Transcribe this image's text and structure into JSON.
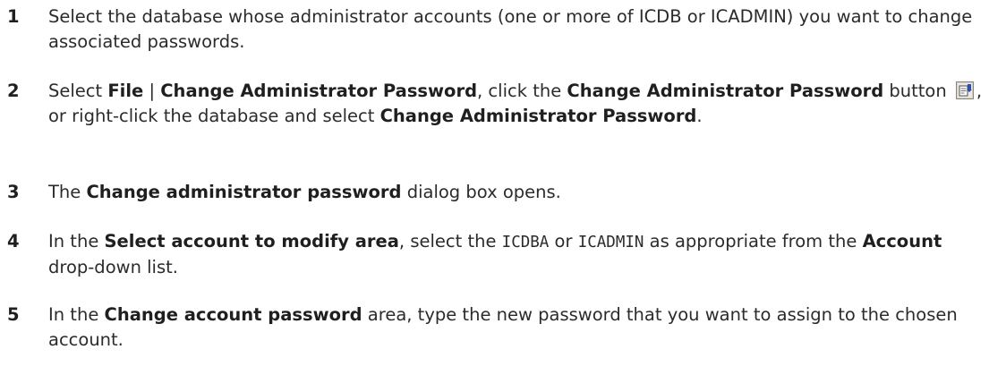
{
  "steps": [
    {
      "number": "1",
      "t1": "Select the database whose administrator accounts (one or more of ICDB or ICADMIN) you want to change associated passwords."
    },
    {
      "number": "2",
      "t1": "Select ",
      "b1": "File",
      "t2": " | ",
      "b2": "Change Administrator Password",
      "t3": ", click the ",
      "b3": "Change Administrator Password",
      "t4": " button ",
      "icon": "change-password-toolbar-icon",
      "t5": ", or right-click the database and select ",
      "b4": "Change Administrator Password",
      "t6": "."
    },
    {
      "number": "3",
      "t1": "The ",
      "b1": "Change administrator password",
      "t2": " dialog box opens."
    },
    {
      "number": "4",
      "t1": "In the ",
      "b1": "Select account to modify area",
      "t2": ",  select the ",
      "c1": "ICDBA",
      "t3": " or ",
      "c2": "ICADMIN",
      "t4": " as appropriate from the ",
      "b2": "Account",
      "t5": " drop-down list."
    },
    {
      "number": "5",
      "t1": "In the ",
      "b1": "Change account password",
      "t2": " area, type the new password that you want to assign to the chosen account."
    }
  ]
}
